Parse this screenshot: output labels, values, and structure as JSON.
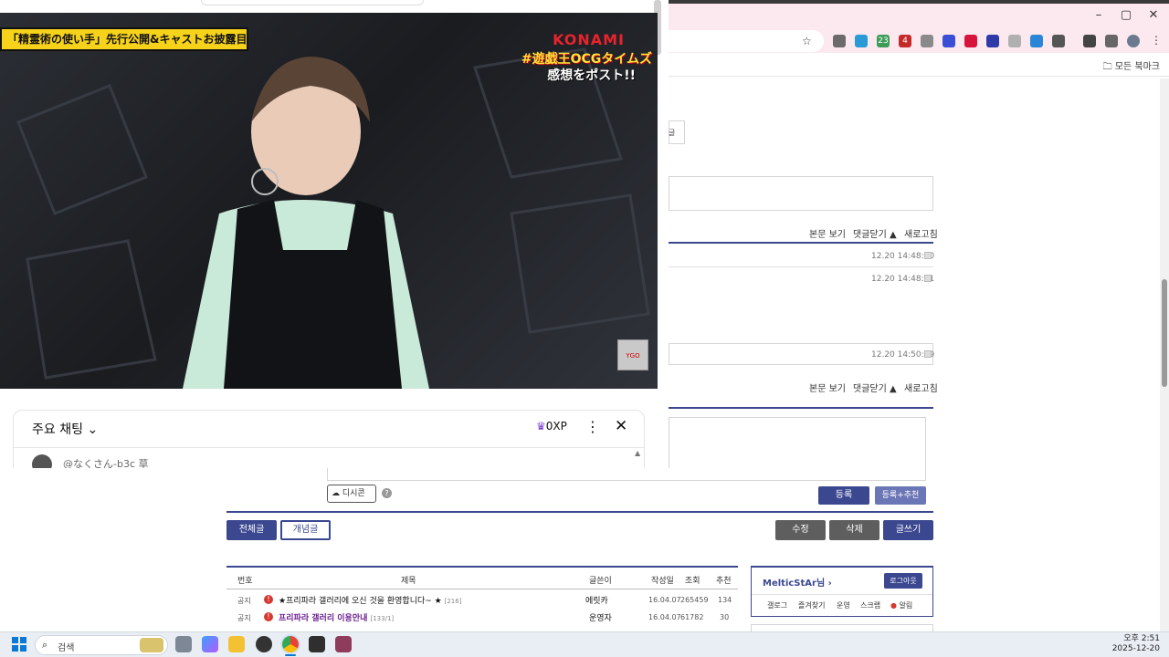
{
  "browser": {
    "window_controls": [
      "–",
      "▢",
      "✕"
    ],
    "bookmarks_label": "모든 북마크",
    "ext_badges": [
      "23",
      "4"
    ]
  },
  "post_links": {
    "view_body": "본문 보기",
    "close_comments": "댓글닫기",
    "refresh": "새로고침"
  },
  "comments": {
    "timestamps": [
      "12.20 14:48:20",
      "12.20 14:48:51",
      "12.20 14:50:09"
    ],
    "fragment": "글"
  },
  "comment_form": {
    "dcon_label": "디시콘",
    "help": "?",
    "submit_label": "등록",
    "submit_recommend_label": "등록+추천"
  },
  "gallery": {
    "tabs": [
      "전체글",
      "개념글"
    ],
    "actions": [
      "수정",
      "삭제",
      "글쓰기"
    ],
    "table_headers": [
      "번호",
      "제목",
      "글쓴이",
      "작성일",
      "조회",
      "추천"
    ],
    "rows": [
      {
        "num": "공지",
        "title": "★프리파라 갤러리에 오신 것을 환영합니다~ ★",
        "count": "[216]",
        "author": "에릿카",
        "date": "16.04.07",
        "views": "265459",
        "rec": "134"
      },
      {
        "num": "공지",
        "title": "프리파라 갤러리 이용안내",
        "count": "[133/1]",
        "author": "운영자",
        "date": "16.04.07",
        "views": "61782",
        "rec": "30"
      }
    ],
    "user_box": {
      "username": "MelticStAr님",
      "logout": "로그아웃",
      "menu": [
        "갤로그",
        "즐겨찾기",
        "운영",
        "스크랩",
        "알림"
      ]
    }
  },
  "video": {
    "banner": "「精霊術の使い手」先行公開&キャストお披露目",
    "brand": "KONAMI",
    "hashtag": "#遊戯王OCGタイムズ",
    "cta": "感想をポスト!!"
  },
  "chat": {
    "title": "주요 채팅",
    "xp": "0XP",
    "user": "@なくさん-b3c",
    "message": "草"
  },
  "taskbar": {
    "search_placeholder": "검색",
    "time": "오후 2:51",
    "date": "2025-12-20"
  },
  "colors": {
    "navy": "#3b4890",
    "banner_yellow": "#f6d21b",
    "konami_red": "#e8232c",
    "tab_pink": "#fbe9ef"
  }
}
